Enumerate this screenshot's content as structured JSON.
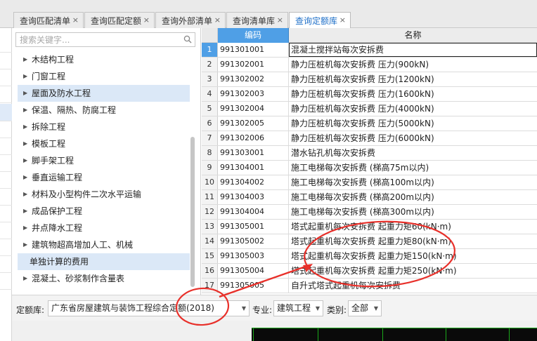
{
  "tabs": [
    {
      "label": "查询匹配清单",
      "close": "×"
    },
    {
      "label": "查询匹配定额",
      "close": "×"
    },
    {
      "label": "查询外部清单",
      "close": "×"
    },
    {
      "label": "查询清单库",
      "close": "×"
    },
    {
      "label": "查询定额库",
      "close": "×"
    }
  ],
  "search": {
    "placeholder": "搜索关键字..."
  },
  "tree": [
    {
      "label": "木结构工程"
    },
    {
      "label": "门窗工程"
    },
    {
      "label": "屋面及防水工程"
    },
    {
      "label": "保温、隔热、防腐工程"
    },
    {
      "label": "拆除工程"
    },
    {
      "label": "模板工程"
    },
    {
      "label": "脚手架工程"
    },
    {
      "label": "垂直运输工程"
    },
    {
      "label": "材料及小型构件二次水平运输"
    },
    {
      "label": "成品保护工程"
    },
    {
      "label": "井点降水工程"
    },
    {
      "label": "建筑物超高增加人工、机械"
    },
    {
      "label": "单独计算的费用"
    },
    {
      "label": "混凝土、砂浆制作含量表"
    }
  ],
  "grid": {
    "col_code": "编码",
    "col_name": "名称",
    "rows": [
      {
        "no": "1",
        "code": "991301001",
        "name": "混凝土搅拌站每次安拆费"
      },
      {
        "no": "2",
        "code": "991302001",
        "name": "静力压桩机每次安拆费 压力(900kN)"
      },
      {
        "no": "3",
        "code": "991302002",
        "name": "静力压桩机每次安拆费 压力(1200kN)"
      },
      {
        "no": "4",
        "code": "991302003",
        "name": "静力压桩机每次安拆费 压力(1600kN)"
      },
      {
        "no": "5",
        "code": "991302004",
        "name": "静力压桩机每次安拆费 压力(4000kN)"
      },
      {
        "no": "6",
        "code": "991302005",
        "name": "静力压桩机每次安拆费 压力(5000kN)"
      },
      {
        "no": "7",
        "code": "991302006",
        "name": "静力压桩机每次安拆费 压力(6000kN)"
      },
      {
        "no": "8",
        "code": "991303001",
        "name": "潜水钻孔机每次安拆费"
      },
      {
        "no": "9",
        "code": "991304001",
        "name": "施工电梯每次安拆费 (梯高75m以内)"
      },
      {
        "no": "10",
        "code": "991304002",
        "name": "施工电梯每次安拆费 (梯高100m以内)"
      },
      {
        "no": "11",
        "code": "991304003",
        "name": "施工电梯每次安拆费 (梯高200m以内)"
      },
      {
        "no": "12",
        "code": "991304004",
        "name": "施工电梯每次安拆费 (梯高300m以内)"
      },
      {
        "no": "13",
        "code": "991305001",
        "name": "塔式起重机每次安拆费 起重力矩60(kN·m)"
      },
      {
        "no": "14",
        "code": "991305002",
        "name": "塔式起重机每次安拆费 起重力矩80(kN·m)"
      },
      {
        "no": "15",
        "code": "991305003",
        "name": "塔式起重机每次安拆费 起重力矩150(kN·m)"
      },
      {
        "no": "16",
        "code": "991305004",
        "name": "塔式起重机每次安拆费 起重力矩250(kN·m)"
      },
      {
        "no": "17",
        "code": "991305005",
        "name": "自升式塔式起重机每次安拆费"
      }
    ]
  },
  "filter": {
    "quota_label": "定额库:",
    "quota_value": "广东省房屋建筑与装饰工程综合定额(2018)",
    "major_label": "专业:",
    "major_value": "建筑工程",
    "type_label": "类别:",
    "type_value": "全部"
  },
  "colors": {
    "accent": "#4f9fe6",
    "annotation": "#e8302a",
    "selection": "#dbe8f7"
  }
}
